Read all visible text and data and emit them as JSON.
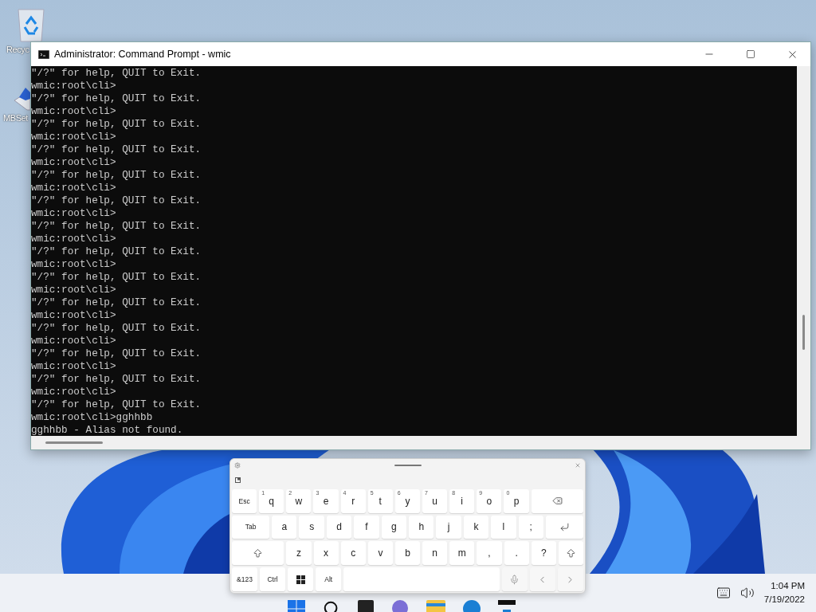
{
  "desktop_icons": [
    {
      "label": "Recyc"
    },
    {
      "label": "MBSet"
    }
  ],
  "window": {
    "title": "Administrator: Command Prompt - wmic",
    "console_lines": [
      "\"/?\" for help, QUIT to Exit.",
      "wmic:root\\cli>",
      "\"/?\" for help, QUIT to Exit.",
      "wmic:root\\cli>",
      "\"/?\" for help, QUIT to Exit.",
      "wmic:root\\cli>",
      "\"/?\" for help, QUIT to Exit.",
      "wmic:root\\cli>",
      "\"/?\" for help, QUIT to Exit.",
      "wmic:root\\cli>",
      "\"/?\" for help, QUIT to Exit.",
      "wmic:root\\cli>",
      "\"/?\" for help, QUIT to Exit.",
      "wmic:root\\cli>",
      "\"/?\" for help, QUIT to Exit.",
      "wmic:root\\cli>",
      "\"/?\" for help, QUIT to Exit.",
      "wmic:root\\cli>",
      "\"/?\" for help, QUIT to Exit.",
      "wmic:root\\cli>",
      "\"/?\" for help, QUIT to Exit.",
      "wmic:root\\cli>",
      "\"/?\" for help, QUIT to Exit.",
      "wmic:root\\cli>",
      "\"/?\" for help, QUIT to Exit.",
      "wmic:root\\cli>",
      "\"/?\" for help, QUIT to Exit.",
      "wmic:root\\cli>gghhbb",
      "gghhbb - Alias not found."
    ]
  },
  "keyboard": {
    "rows": [
      {
        "keys": [
          {
            "kind": "key",
            "label": "Esc"
          },
          {
            "kind": "key",
            "label": "q",
            "hint": "1"
          },
          {
            "kind": "key",
            "label": "w",
            "hint": "2"
          },
          {
            "kind": "key",
            "label": "e",
            "hint": "3"
          },
          {
            "kind": "key",
            "label": "r",
            "hint": "4"
          },
          {
            "kind": "key",
            "label": "t",
            "hint": "5"
          },
          {
            "kind": "key",
            "label": "y",
            "hint": "6"
          },
          {
            "kind": "key",
            "label": "u",
            "hint": "7"
          },
          {
            "kind": "key",
            "label": "i",
            "hint": "8"
          },
          {
            "kind": "key",
            "label": "o",
            "hint": "9"
          },
          {
            "kind": "key",
            "label": "p",
            "hint": "0"
          },
          {
            "kind": "backspace"
          }
        ]
      },
      {
        "keys": [
          {
            "kind": "key",
            "label": "Tab"
          },
          {
            "kind": "key",
            "label": "a"
          },
          {
            "kind": "key",
            "label": "s"
          },
          {
            "kind": "key",
            "label": "d"
          },
          {
            "kind": "key",
            "label": "f"
          },
          {
            "kind": "key",
            "label": "g"
          },
          {
            "kind": "key",
            "label": "h"
          },
          {
            "kind": "key",
            "label": "j"
          },
          {
            "kind": "key",
            "label": "k"
          },
          {
            "kind": "key",
            "label": "l"
          },
          {
            "kind": "key",
            "label": ";"
          },
          {
            "kind": "enter"
          }
        ]
      },
      {
        "keys": [
          {
            "kind": "shift"
          },
          {
            "kind": "key",
            "label": "z"
          },
          {
            "kind": "key",
            "label": "x"
          },
          {
            "kind": "key",
            "label": "c"
          },
          {
            "kind": "key",
            "label": "v"
          },
          {
            "kind": "key",
            "label": "b"
          },
          {
            "kind": "key",
            "label": "n"
          },
          {
            "kind": "key",
            "label": "m"
          },
          {
            "kind": "key",
            "label": ","
          },
          {
            "kind": "key",
            "label": "."
          },
          {
            "kind": "key",
            "label": "?"
          },
          {
            "kind": "shift"
          }
        ]
      },
      {
        "keys": [
          {
            "kind": "key",
            "label": "&123"
          },
          {
            "kind": "key",
            "label": "Ctrl"
          },
          {
            "kind": "windows"
          },
          {
            "kind": "key",
            "label": "Alt"
          },
          {
            "kind": "space"
          },
          {
            "kind": "mic"
          },
          {
            "kind": "left"
          },
          {
            "kind": "right"
          }
        ]
      }
    ]
  },
  "taskbar": {
    "time": "1:04 PM",
    "date": "7/19/2022"
  }
}
